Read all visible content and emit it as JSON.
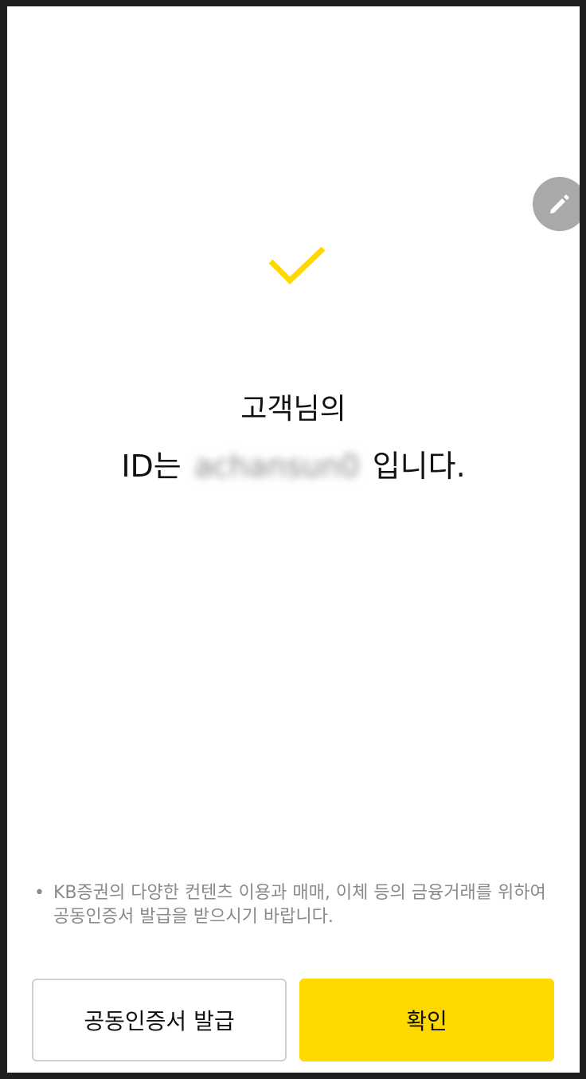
{
  "result": {
    "line1": "고객님의",
    "id_prefix": "ID는",
    "id_value": "achansun0",
    "id_suffix": "입니다."
  },
  "notice": {
    "bullet": "•",
    "text": "KB증권의 다양한 컨텐츠 이용과 매매, 이체 등의 금융거래를 위하여 공동인증서 발급을 받으시기 바랍니다."
  },
  "buttons": {
    "certificate_label": "공동인증서 발급",
    "confirm_label": "확인"
  },
  "icons": {
    "check": "check-icon",
    "edit": "pencil-icon"
  },
  "colors": {
    "accent": "#FFD800",
    "fab": "#A9A9A9",
    "muted_text": "#8A8A8A"
  }
}
